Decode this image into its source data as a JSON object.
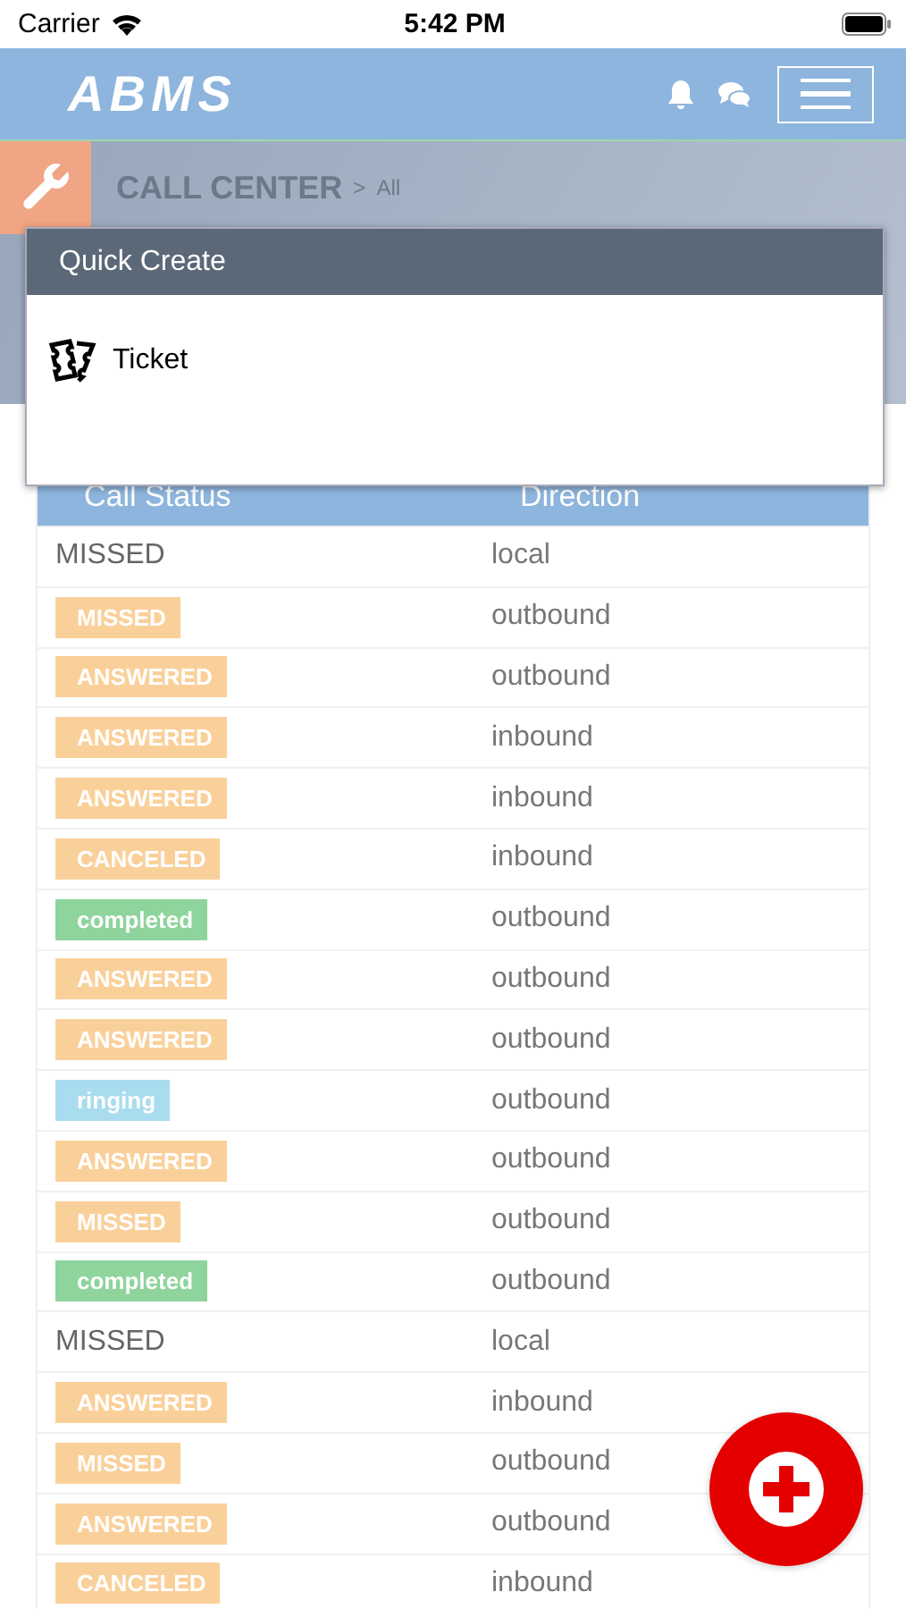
{
  "status_bar": {
    "carrier": "Carrier",
    "time": "5:42 PM"
  },
  "header": {
    "logo": "ABMS"
  },
  "breadcrumb": {
    "section": "CALL CENTER",
    "separator": ">",
    "current": "All"
  },
  "quick_create": {
    "title": "Quick Create",
    "items": [
      {
        "label": "Ticket"
      }
    ]
  },
  "table": {
    "columns": [
      "Call Status",
      "Direction"
    ],
    "rows": [
      {
        "status": {
          "text": "MISSED",
          "kind": "text"
        },
        "direction": "local"
      },
      {
        "status": {
          "text": "MISSED",
          "kind": "badge",
          "color": "#fad09a"
        },
        "direction": "outbound"
      },
      {
        "status": {
          "text": "ANSWERED",
          "kind": "badge",
          "color": "#fad09a"
        },
        "direction": "outbound"
      },
      {
        "status": {
          "text": "ANSWERED",
          "kind": "badge",
          "color": "#fad09a"
        },
        "direction": "inbound"
      },
      {
        "status": {
          "text": "ANSWERED",
          "kind": "badge",
          "color": "#fad09a"
        },
        "direction": "inbound"
      },
      {
        "status": {
          "text": "CANCELED",
          "kind": "badge",
          "color": "#fad09a"
        },
        "direction": "inbound"
      },
      {
        "status": {
          "text": "completed",
          "kind": "badge",
          "color": "#8ed49c"
        },
        "direction": "outbound"
      },
      {
        "status": {
          "text": "ANSWERED",
          "kind": "badge",
          "color": "#fad09a"
        },
        "direction": "outbound"
      },
      {
        "status": {
          "text": "ANSWERED",
          "kind": "badge",
          "color": "#fad09a"
        },
        "direction": "outbound"
      },
      {
        "status": {
          "text": "ringing",
          "kind": "badge",
          "color": "#a9dcef"
        },
        "direction": "outbound"
      },
      {
        "status": {
          "text": "ANSWERED",
          "kind": "badge",
          "color": "#fad09a"
        },
        "direction": "outbound"
      },
      {
        "status": {
          "text": "MISSED",
          "kind": "badge",
          "color": "#fad09a"
        },
        "direction": "outbound"
      },
      {
        "status": {
          "text": "completed",
          "kind": "badge",
          "color": "#8ed49c"
        },
        "direction": "outbound"
      },
      {
        "status": {
          "text": "MISSED",
          "kind": "text"
        },
        "direction": "local"
      },
      {
        "status": {
          "text": "ANSWERED",
          "kind": "badge",
          "color": "#fad09a"
        },
        "direction": "inbound"
      },
      {
        "status": {
          "text": "MISSED",
          "kind": "badge",
          "color": "#fad09a"
        },
        "direction": "outbound"
      },
      {
        "status": {
          "text": "ANSWERED",
          "kind": "badge",
          "color": "#fad09a"
        },
        "direction": "outbound"
      },
      {
        "status": {
          "text": "CANCELED",
          "kind": "badge",
          "color": "#fad09a"
        },
        "direction": "inbound"
      }
    ]
  }
}
